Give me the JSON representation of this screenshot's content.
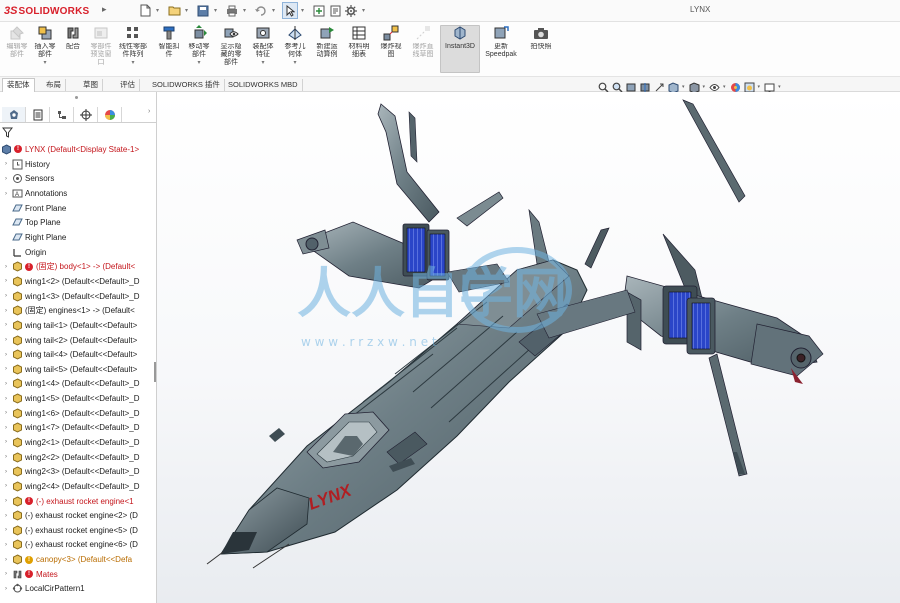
{
  "app": {
    "logo_prefix": "3S",
    "logo_text": "SOLIDWORKS",
    "document_title": "LYNX"
  },
  "quick_access": [
    {
      "name": "new-document",
      "icon": "new-file-icon"
    },
    {
      "name": "open-document",
      "icon": "open-folder-icon"
    },
    {
      "name": "save",
      "icon": "save-icon"
    },
    {
      "name": "print",
      "icon": "print-icon"
    },
    {
      "name": "undo",
      "icon": "undo-icon"
    },
    {
      "name": "select",
      "icon": "cursor-arrow-icon"
    },
    {
      "name": "rebuild",
      "icon": "rebuild-icon"
    },
    {
      "name": "file-properties",
      "icon": "file-properties-icon"
    },
    {
      "name": "options",
      "icon": "gear-icon"
    }
  ],
  "ribbon": {
    "buttons": [
      {
        "label": "编辑零\n部件",
        "icon": "edit-component-icon",
        "disabled": true
      },
      {
        "label": "插入零\n部件",
        "icon": "insert-component-icon",
        "disabled": false
      },
      {
        "label": "配合",
        "icon": "mate-icon",
        "disabled": false
      },
      {
        "label": "零部件\n预览窗\n口",
        "icon": "component-preview-icon",
        "disabled": true
      },
      {
        "label": "线性零部\n件阵列",
        "icon": "linear-pattern-icon",
        "disabled": false
      },
      {
        "label": "智能扣\n件",
        "icon": "smart-fasteners-icon",
        "disabled": false
      },
      {
        "label": "移动零\n部件",
        "icon": "move-component-icon",
        "disabled": false
      },
      {
        "label": "显示隐\n藏的零\n部件",
        "icon": "show-hidden-icon",
        "disabled": false
      },
      {
        "label": "装配体\n特征",
        "icon": "assembly-features-icon",
        "disabled": false
      },
      {
        "label": "参考几\n何体",
        "icon": "reference-geometry-icon",
        "disabled": false
      },
      {
        "label": "新建运\n动算例",
        "icon": "motion-study-icon",
        "disabled": false
      },
      {
        "label": "材料明\n细表",
        "icon": "bom-icon",
        "disabled": false
      },
      {
        "label": "爆炸视\n图",
        "icon": "exploded-view-icon",
        "disabled": false
      },
      {
        "label": "爆炸直\n线草图",
        "icon": "explode-line-sketch-icon",
        "disabled": true
      },
      {
        "label": "Instant3D",
        "icon": "instant3d-icon",
        "disabled": false,
        "active": true
      },
      {
        "label": "更新\nSpeedpak",
        "icon": "speedpak-icon",
        "disabled": false
      },
      {
        "label": "拍快照",
        "icon": "camera-icon",
        "disabled": false
      }
    ]
  },
  "tabs": [
    {
      "label": "装配体",
      "active": true
    },
    {
      "label": "布局",
      "active": false
    },
    {
      "label": "草图",
      "active": false
    },
    {
      "label": "评估",
      "active": false
    },
    {
      "label": "SOLIDWORKS 插件",
      "active": false
    },
    {
      "label": "SOLIDWORKS MBD",
      "active": false
    }
  ],
  "view_toolbar": [
    {
      "icon": "zoom-to-fit-icon"
    },
    {
      "icon": "zoom-to-area-icon"
    },
    {
      "icon": "previous-view-icon"
    },
    {
      "icon": "section-view-icon"
    },
    {
      "icon": "dynamic-annotation-icon"
    },
    {
      "icon": "view-orientation-icon"
    },
    {
      "icon": "display-style-icon"
    },
    {
      "icon": "hide-show-items-icon"
    },
    {
      "icon": "edit-appearance-icon"
    },
    {
      "icon": "apply-scene-icon"
    },
    {
      "icon": "view-settings-icon"
    }
  ],
  "panel_tabs": [
    {
      "icon": "featuremanager-icon",
      "active": true
    },
    {
      "icon": "propertymanager-icon",
      "active": false
    },
    {
      "icon": "configuration-manager-icon",
      "active": false
    },
    {
      "icon": "dimxpert-icon",
      "active": false
    },
    {
      "icon": "display-manager-icon",
      "active": false
    }
  ],
  "tree": {
    "root": "LYNX  (Default<Display State-1>",
    "items": [
      {
        "label": "History",
        "icon": "history-icon",
        "kind": "normal"
      },
      {
        "label": "Sensors",
        "icon": "sensors-icon",
        "kind": "normal"
      },
      {
        "label": "Annotations",
        "icon": "annotations-icon",
        "kind": "normal"
      },
      {
        "label": "Front Plane",
        "icon": "plane-icon",
        "kind": "normal"
      },
      {
        "label": "Top Plane",
        "icon": "plane-icon",
        "kind": "normal"
      },
      {
        "label": "Right Plane",
        "icon": "plane-icon",
        "kind": "normal"
      },
      {
        "label": "Origin",
        "icon": "origin-icon",
        "kind": "normal"
      },
      {
        "label": "(固定) body<1> -> (Default<",
        "icon": "part-icon",
        "kind": "red",
        "badge": "error"
      },
      {
        "label": "wing1<2> (Default<<Default>_D",
        "icon": "part-icon",
        "kind": "normal"
      },
      {
        "label": "wing1<3> (Default<<Default>_D",
        "icon": "part-icon",
        "kind": "normal"
      },
      {
        "label": "(固定) engines<1> -> (Default<",
        "icon": "part-icon",
        "kind": "normal"
      },
      {
        "label": "wing tail<1> (Default<<Default>",
        "icon": "part-icon",
        "kind": "normal"
      },
      {
        "label": "wing tail<2> (Default<<Default>",
        "icon": "part-icon",
        "kind": "normal"
      },
      {
        "label": "wing tail<4> (Default<<Default>",
        "icon": "part-icon",
        "kind": "normal"
      },
      {
        "label": "wing tail<5> (Default<<Default>",
        "icon": "part-icon",
        "kind": "normal"
      },
      {
        "label": "wing1<4> (Default<<Default>_D",
        "icon": "part-icon",
        "kind": "normal"
      },
      {
        "label": "wing1<5> (Default<<Default>_D",
        "icon": "part-icon",
        "kind": "normal"
      },
      {
        "label": "wing1<6> (Default<<Default>_D",
        "icon": "part-icon",
        "kind": "normal"
      },
      {
        "label": "wing1<7> (Default<<Default>_D",
        "icon": "part-icon",
        "kind": "normal"
      },
      {
        "label": "wing2<1> (Default<<Default>_D",
        "icon": "part-icon",
        "kind": "normal"
      },
      {
        "label": "wing2<2> (Default<<Default>_D",
        "icon": "part-icon",
        "kind": "normal"
      },
      {
        "label": "wing2<3> (Default<<Default>_D",
        "icon": "part-icon",
        "kind": "normal"
      },
      {
        "label": "wing2<4> (Default<<Default>_D",
        "icon": "part-icon",
        "kind": "normal"
      },
      {
        "label": "(-) exhaust rocket engine<1",
        "icon": "part-icon",
        "kind": "red",
        "badge": "error"
      },
      {
        "label": "(-) exhaust rocket engine<2> (D",
        "icon": "part-icon",
        "kind": "normal"
      },
      {
        "label": "(-) exhaust rocket engine<5> (D",
        "icon": "part-icon",
        "kind": "normal"
      },
      {
        "label": "(-) exhaust rocket engine<6> (D",
        "icon": "part-icon",
        "kind": "normal"
      },
      {
        "label": "canopy<3> (Default<<Defa",
        "icon": "part-icon",
        "kind": "orange",
        "badge": "warning"
      },
      {
        "label": "Mates",
        "icon": "mates-icon",
        "kind": "red",
        "badge": "error"
      },
      {
        "label": "LocalCirPattern1",
        "icon": "circular-pattern-icon",
        "kind": "normal"
      }
    ]
  },
  "model": {
    "decal_text": "LYNX",
    "watermark_text": "人人自学网",
    "watermark_sub": "w w w . r r z x w . n e t"
  },
  "colors": {
    "accent_red": "#d8202b",
    "tree_error_red": "#c4161c",
    "tree_warning": "#b96c00",
    "hull": "#6e7f86",
    "panel_blue": "#2a45c8",
    "watermark": "#6fb3e0"
  }
}
